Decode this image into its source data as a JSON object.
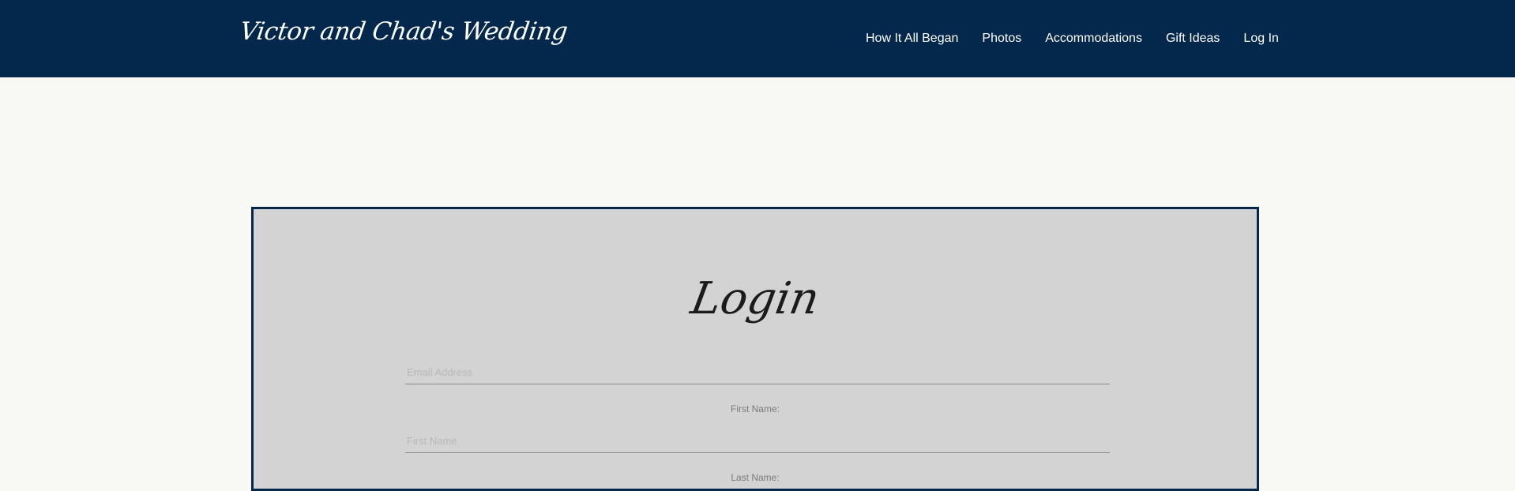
{
  "site": {
    "title": "Victor and Chad's Wedding"
  },
  "nav": {
    "items": [
      {
        "label": "How It All Began"
      },
      {
        "label": "Photos"
      },
      {
        "label": "Accommodations"
      },
      {
        "label": "Gift Ideas"
      },
      {
        "label": "Log In"
      }
    ]
  },
  "login": {
    "title": "Login",
    "email_placeholder": "Email Address",
    "first_name_label": "First Name:",
    "first_name_placeholder": "First Name",
    "last_name_label": "Last Name:"
  },
  "colors": {
    "header_bg": "#03284c",
    "page_bg": "#f8f8f4",
    "panel_bg": "#d3d3d3"
  }
}
